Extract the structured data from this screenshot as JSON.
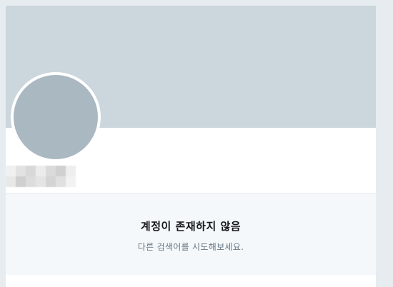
{
  "profile": {
    "username_redacted": true
  },
  "empty_state": {
    "title": "계정이 존재하지 않음",
    "subtitle": "다른 검색어를 시도해보세요."
  },
  "colors": {
    "page_background": "#e6ecf0",
    "banner": "#ccd6dd",
    "avatar": "#aab8c2",
    "empty_state_background": "#f5f8fa",
    "title_text": "#14171a",
    "subtitle_text": "#657786"
  }
}
